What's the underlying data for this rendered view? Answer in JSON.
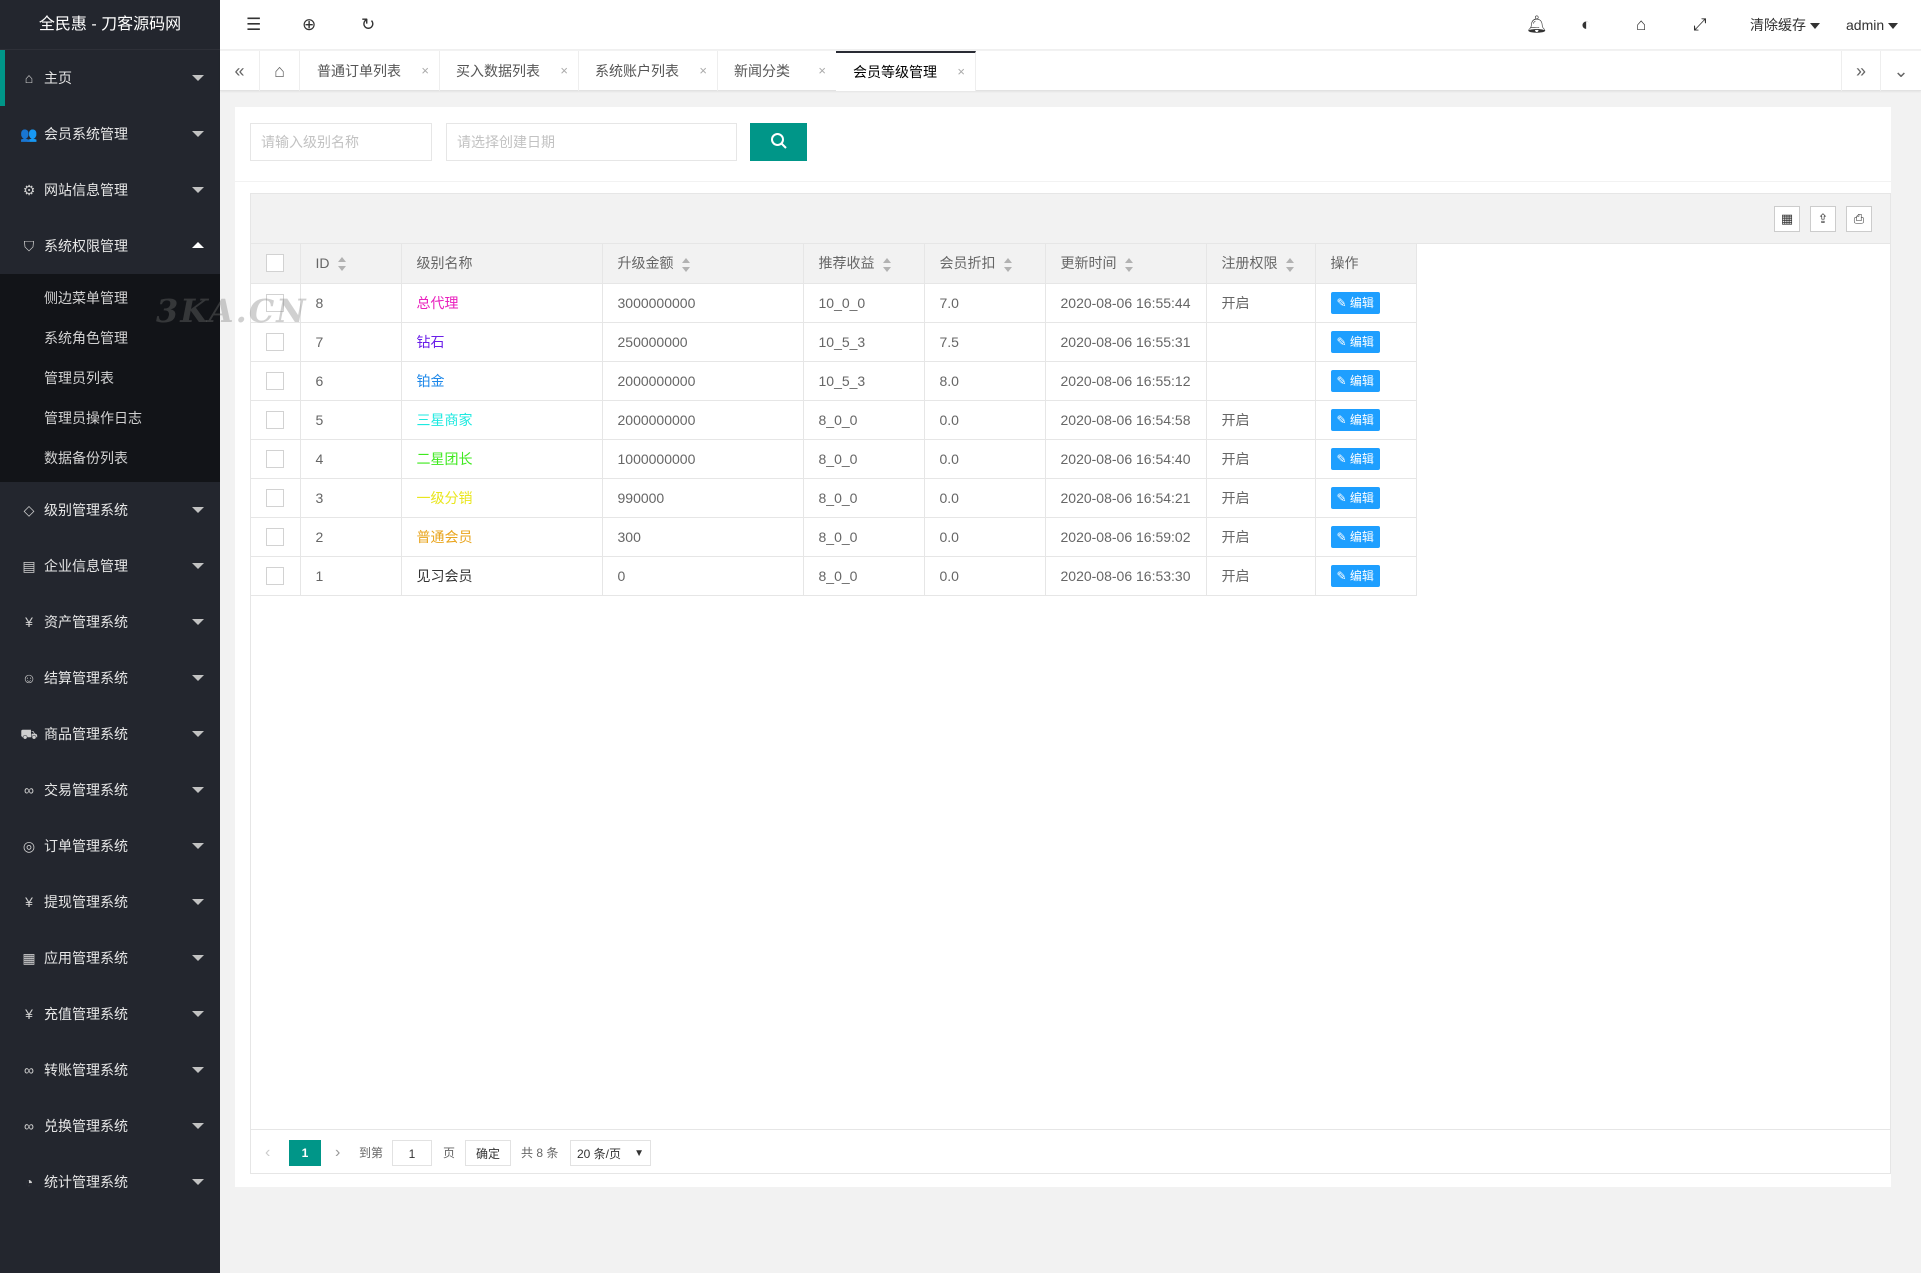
{
  "app": {
    "title": "全民惠 - 刀客源码网"
  },
  "sidebar": {
    "items": [
      {
        "icon": "home-icon",
        "glyph": "⌂",
        "label": "主页"
      },
      {
        "icon": "users-icon",
        "glyph": "👥",
        "label": "会员系统管理"
      },
      {
        "icon": "settings-icon",
        "glyph": "⚙",
        "label": "网站信息管理"
      },
      {
        "icon": "shield-icon",
        "glyph": "⛉",
        "label": "系统权限管理",
        "expanded": true
      },
      {
        "icon": "diamond-icon",
        "glyph": "◇",
        "label": "级别管理系统"
      },
      {
        "icon": "company-icon",
        "glyph": "▤",
        "label": "企业信息管理"
      },
      {
        "icon": "yen-icon",
        "glyph": "¥",
        "label": "资产管理系统"
      },
      {
        "icon": "smile-icon",
        "glyph": "☺",
        "label": "结算管理系统"
      },
      {
        "icon": "cart-icon",
        "glyph": "⛟",
        "label": "商品管理系统"
      },
      {
        "icon": "link-icon",
        "glyph": "∞",
        "label": "交易管理系统"
      },
      {
        "icon": "location-icon",
        "glyph": "◎",
        "label": "订单管理系统"
      },
      {
        "icon": "yen-icon",
        "glyph": "¥",
        "label": "提现管理系统"
      },
      {
        "icon": "apps-icon",
        "glyph": "▦",
        "label": "应用管理系统"
      },
      {
        "icon": "yen-icon",
        "glyph": "¥",
        "label": "充值管理系统"
      },
      {
        "icon": "link-icon",
        "glyph": "∞",
        "label": "转账管理系统"
      },
      {
        "icon": "link-icon",
        "glyph": "∞",
        "label": "兑换管理系统"
      },
      {
        "icon": "gauge-icon",
        "glyph": "◔",
        "label": "统计管理系统"
      }
    ],
    "subitems": [
      "侧边菜单管理",
      "系统角色管理",
      "管理员列表",
      "管理员操作日志",
      "数据备份列表"
    ]
  },
  "header": {
    "clear_cache": "清除缓存",
    "user": "admin"
  },
  "tabs": [
    {
      "label": "普通订单列表"
    },
    {
      "label": "买入数据列表"
    },
    {
      "label": "系统账户列表"
    },
    {
      "label": "新闻分类"
    },
    {
      "label": "会员等级管理",
      "active": true
    }
  ],
  "search": {
    "name_placeholder": "请输入级别名称",
    "date_placeholder": "请选择创建日期"
  },
  "table": {
    "headers": [
      "ID",
      "级别名称",
      "升级金额",
      "推荐收益",
      "会员折扣",
      "更新时间",
      "注册权限",
      "操作"
    ],
    "edit_label": "编辑",
    "rows": [
      {
        "id": "8",
        "name": "总代理",
        "color": "#e91ebd",
        "amount": "3000000000",
        "reward": "10_0_0",
        "discount": "7.0",
        "time": "2020-08-06 16:55:44",
        "perm": "开启"
      },
      {
        "id": "7",
        "name": "钻石",
        "color": "#6a1ee9",
        "amount": "250000000",
        "reward": "10_5_3",
        "discount": "7.5",
        "time": "2020-08-06 16:55:31",
        "perm": ""
      },
      {
        "id": "6",
        "name": "铂金",
        "color": "#1e88e9",
        "amount": "2000000000",
        "reward": "10_5_3",
        "discount": "8.0",
        "time": "2020-08-06 16:55:12",
        "perm": ""
      },
      {
        "id": "5",
        "name": "三星商家",
        "color": "#1ee9e0",
        "amount": "2000000000",
        "reward": "8_0_0",
        "discount": "0.0",
        "time": "2020-08-06 16:54:58",
        "perm": "开启"
      },
      {
        "id": "4",
        "name": "二星团长",
        "color": "#3ee91e",
        "amount": "1000000000",
        "reward": "8_0_0",
        "discount": "0.0",
        "time": "2020-08-06 16:54:40",
        "perm": "开启"
      },
      {
        "id": "3",
        "name": "一级分销",
        "color": "#e9e61e",
        "amount": "990000",
        "reward": "8_0_0",
        "discount": "0.0",
        "time": "2020-08-06 16:54:21",
        "perm": "开启"
      },
      {
        "id": "2",
        "name": "普通会员",
        "color": "#e9a51e",
        "amount": "300",
        "reward": "8_0_0",
        "discount": "0.0",
        "time": "2020-08-06 16:59:02",
        "perm": "开启"
      },
      {
        "id": "1",
        "name": "见习会员",
        "color": "#333333",
        "amount": "0",
        "reward": "8_0_0",
        "discount": "0.0",
        "time": "2020-08-06 16:53:30",
        "perm": "开启"
      }
    ]
  },
  "pager": {
    "current": "1",
    "goto_label": "到第",
    "page_input": "1",
    "page_unit": "页",
    "confirm": "确定",
    "total": "共 8 条",
    "per_page": "20 条/页"
  },
  "watermark": "3KA.CN"
}
